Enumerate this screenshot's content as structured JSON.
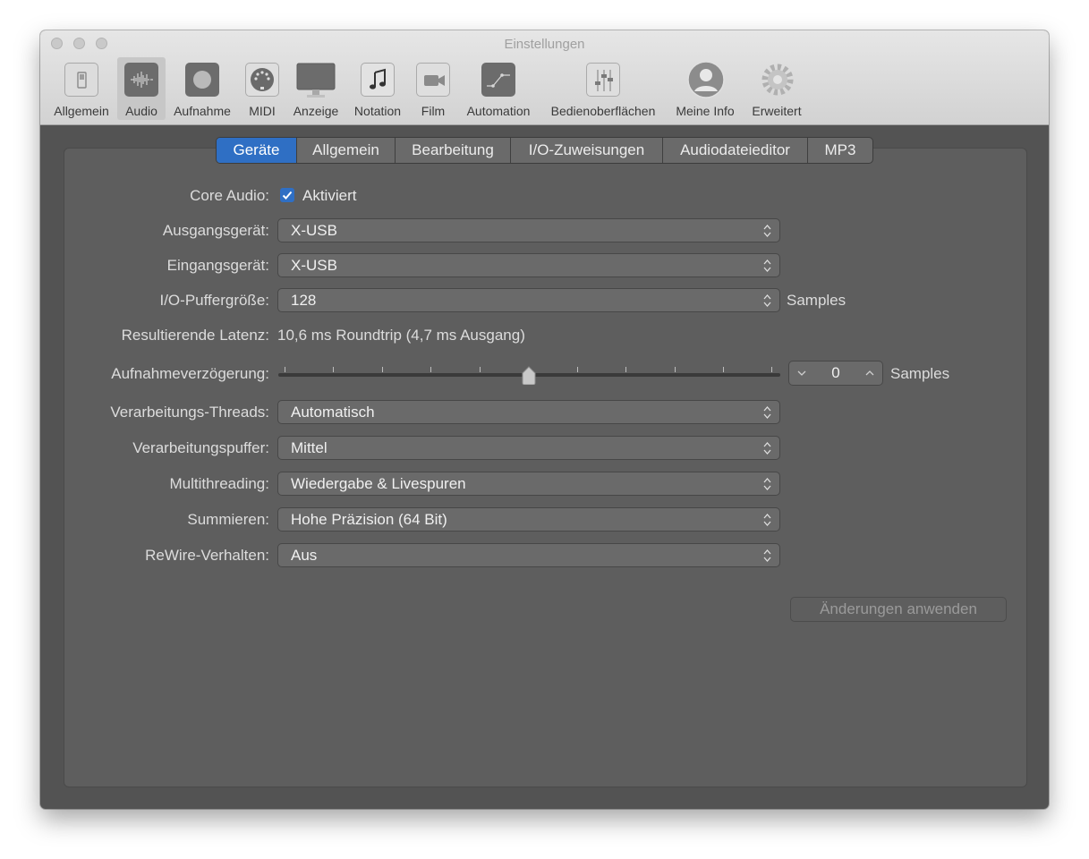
{
  "window": {
    "title": "Einstellungen"
  },
  "toolbar": {
    "items": [
      {
        "label": "Allgemein",
        "icon": "switch-icon"
      },
      {
        "label": "Audio",
        "icon": "waveform-icon",
        "selected": true
      },
      {
        "label": "Aufnahme",
        "icon": "record-icon"
      },
      {
        "label": "MIDI",
        "icon": "midi-plug-icon"
      },
      {
        "label": "Anzeige",
        "icon": "monitor-icon"
      },
      {
        "label": "Notation",
        "icon": "music-note-icon"
      },
      {
        "label": "Film",
        "icon": "video-camera-icon"
      },
      {
        "label": "Automation",
        "icon": "automation-curve-icon"
      },
      {
        "label": "Bedienoberflächen",
        "icon": "faders-icon"
      },
      {
        "label": "Meine Info",
        "icon": "person-icon"
      },
      {
        "label": "Erweitert",
        "icon": "gear-icon"
      }
    ]
  },
  "tabs": [
    "Geräte",
    "Allgemein",
    "Bearbeitung",
    "I/O-Zuweisungen",
    "Audiodateieditor",
    "MP3"
  ],
  "active_tab": "Geräte",
  "form": {
    "core_audio_label": "Core Audio:",
    "core_audio_checkbox_label": "Aktiviert",
    "core_audio_checked": true,
    "output_label": "Ausgangsgerät:",
    "output_value": "X-USB",
    "input_label": "Eingangsgerät:",
    "input_value": "X-USB",
    "buffer_label": "I/O-Puffergröße:",
    "buffer_value": "128",
    "buffer_unit": "Samples",
    "latency_label": "Resultierende Latenz:",
    "latency_value": "10,6 ms Roundtrip (4,7 ms Ausgang)",
    "delay_label": "Aufnahmeverzögerung:",
    "delay_value": "0",
    "delay_unit": "Samples",
    "delay_slider_position": 0.5,
    "threads_label": "Verarbeitungs-Threads:",
    "threads_value": "Automatisch",
    "procbuffer_label": "Verarbeitungspuffer:",
    "procbuffer_value": "Mittel",
    "multithreading_label": "Multithreading:",
    "multithreading_value": "Wiedergabe & Livespuren",
    "summing_label": "Summieren:",
    "summing_value": "Hohe Präzision (64 Bit)",
    "rewire_label": "ReWire-Verhalten:",
    "rewire_value": "Aus",
    "apply_button": "Änderungen anwenden"
  },
  "colors": {
    "accent": "#2f6fc4",
    "window_bg": "#535353",
    "panel_bg": "#5e5e5e",
    "toolbar_bg": "#d9d9d9"
  }
}
